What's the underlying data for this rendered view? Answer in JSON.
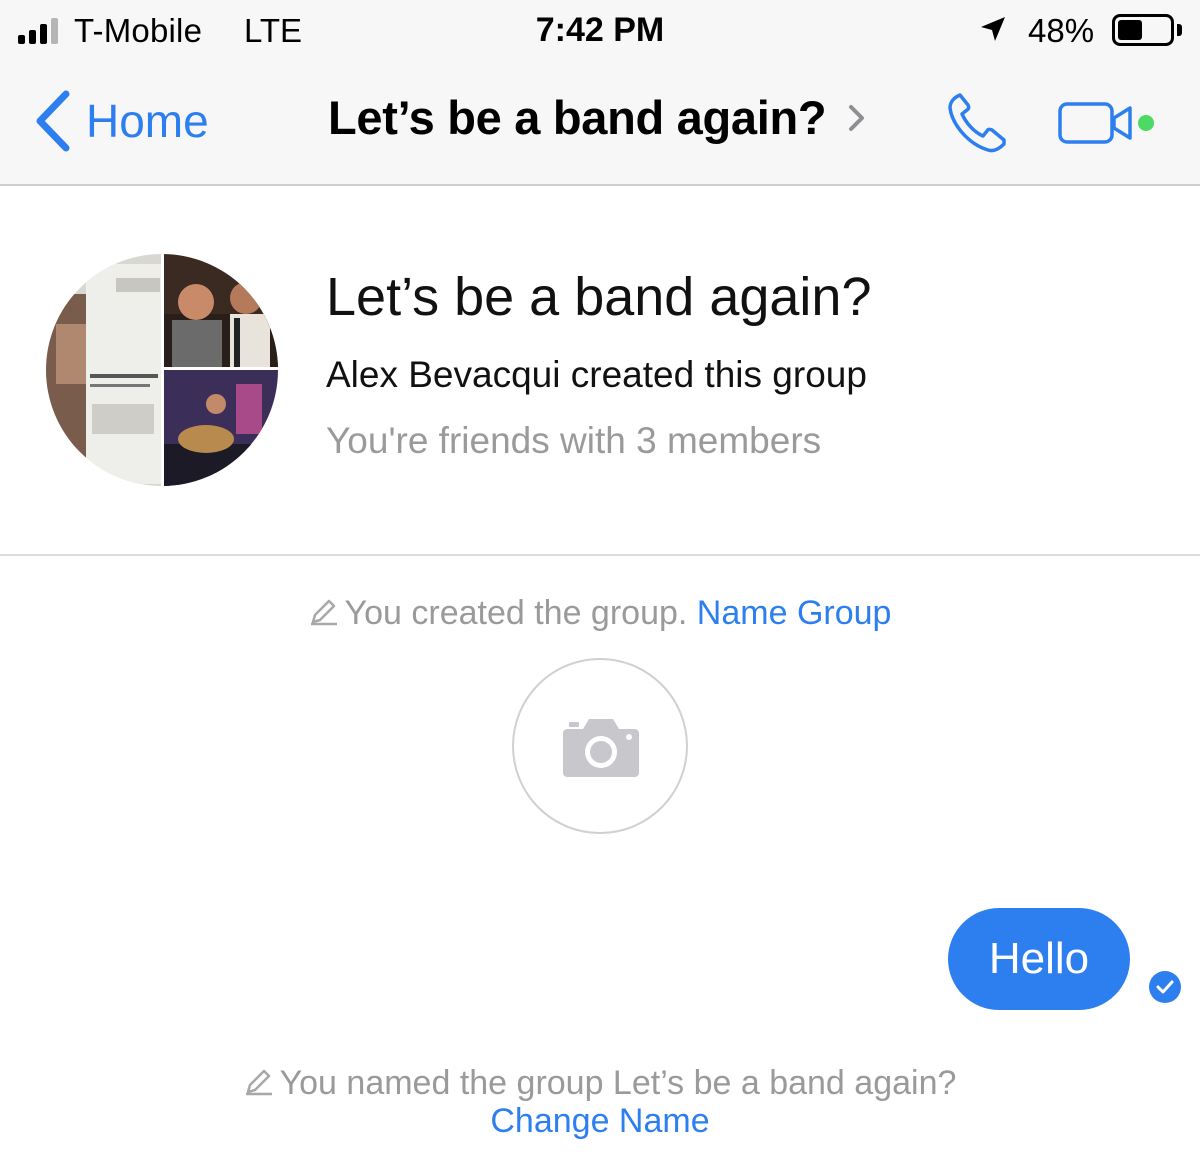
{
  "status_bar": {
    "carrier": "T-Mobile",
    "network": "LTE",
    "time": "7:42 PM",
    "battery_percent": "48%",
    "battery_level": 0.48,
    "signal_bars_active": 3,
    "icons": [
      "signal-icon",
      "location-arrow-icon",
      "battery-icon"
    ]
  },
  "nav": {
    "back_label": "Home",
    "title": "Let’s be a band again?",
    "icons": [
      "chevron-left-icon",
      "chevron-right-icon",
      "phone-icon",
      "video-camera-icon"
    ],
    "accent_color": "#2d7ff0",
    "online_dot_color": "#4cd964"
  },
  "group": {
    "title": "Let’s be a band again?",
    "creator_text": "Alex Bevacqui created this group",
    "friends_text": "You're friends with 3 members",
    "avatar_icon": "group-photo-collage"
  },
  "conversation": {
    "created_text": "You created the group.",
    "name_group_link": "Name Group",
    "camera_icon": "camera-icon",
    "message": {
      "text": "Hello",
      "bubble_color": "#2d7ff0",
      "status_icon": "sent-check-icon"
    },
    "renamed_text": "You named the group Let’s be a band again?",
    "change_name_link": "Change Name"
  }
}
